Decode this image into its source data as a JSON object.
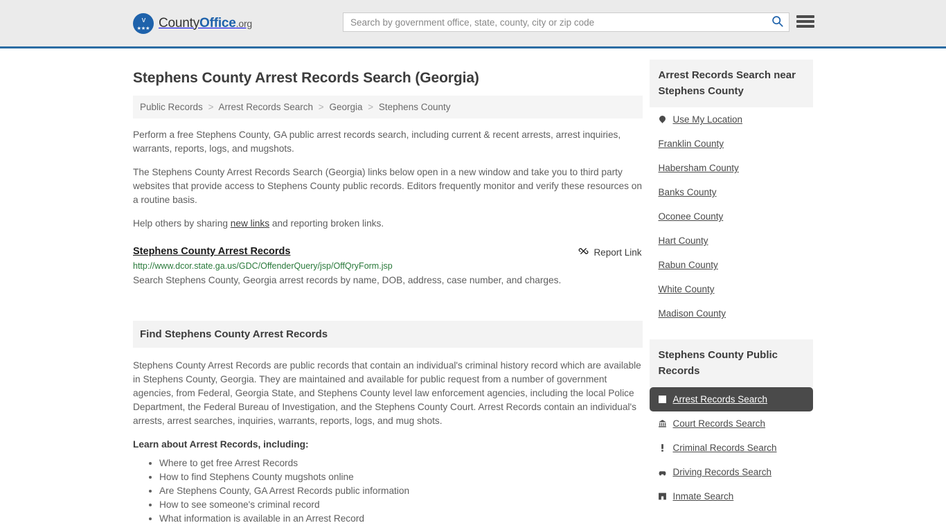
{
  "header": {
    "logo": {
      "county_text": "County",
      "office_text": "Office",
      "org_text": ".org",
      "eagle_glyph": "ᴠ",
      "stars_glyph": "★★★"
    },
    "search": {
      "placeholder": "Search by government office, state, county, city or zip code",
      "value": "",
      "search_icon": "search-icon"
    },
    "menu_icon": "hamburger-menu-icon"
  },
  "page": {
    "title": "Stephens County Arrest Records Search (Georgia)",
    "breadcrumb": [
      "Public Records",
      "Arrest Records Search",
      "Georgia",
      "Stephens County"
    ],
    "breadcrumb_separator": ">",
    "paragraphs": [
      "Perform a free Stephens County, GA public arrest records search, including current & recent arrests, arrest inquiries, warrants, reports, logs, and mugshots.",
      "The Stephens County Arrest Records Search (Georgia) links below open in a new window and take you to third party websites that provide access to Stephens County public records. Editors frequently monitor and verify these resources on a routine basis."
    ],
    "help_line": {
      "before": "Help others by sharing ",
      "link": "new links",
      "after": " and reporting broken links."
    },
    "result": {
      "title": "Stephens County Arrest Records",
      "report_label": "Report Link",
      "report_icon": "broken-link-icon",
      "url": "http://www.dcor.state.ga.us/GDC/OffenderQuery/jsp/OffQryForm.jsp",
      "description": "Search Stephens County, Georgia arrest records by name, DOB, address, case number, and charges."
    },
    "find_section": {
      "heading": "Find Stephens County Arrest Records",
      "body": "Stephens County Arrest Records are public records that contain an individual's criminal history record which are available in Stephens County, Georgia. They are maintained and available for public request from a number of government agencies, from Federal, Georgia State, and Stephens County level law enforcement agencies, including the local Police Department, the Federal Bureau of Investigation, and the Stephens County Court. Arrest Records contain an individual's arrests, arrest searches, inquiries, warrants, reports, logs, and mug shots.",
      "learn_title": "Learn about Arrest Records, including:",
      "learn_items": [
        "Where to get free Arrest Records",
        "How to find Stephens County mugshots online",
        "Are Stephens County, GA Arrest Records public information",
        "How to see someone's criminal record",
        "What information is available in an Arrest Record"
      ]
    }
  },
  "sidebar": {
    "nearby": {
      "heading": "Arrest Records Search near Stephens County",
      "items": [
        {
          "label": "Use My Location",
          "icon": "map-pin-icon"
        },
        {
          "label": "Franklin County",
          "icon": ""
        },
        {
          "label": "Habersham County",
          "icon": ""
        },
        {
          "label": "Banks County",
          "icon": ""
        },
        {
          "label": "Oconee County",
          "icon": ""
        },
        {
          "label": "Hart County",
          "icon": ""
        },
        {
          "label": "Rabun County",
          "icon": ""
        },
        {
          "label": "White County",
          "icon": ""
        },
        {
          "label": "Madison County",
          "icon": ""
        }
      ]
    },
    "public_records": {
      "heading": "Stephens County Public Records",
      "items": [
        {
          "label": "Arrest Records Search",
          "icon": "fingerprint-card-icon",
          "active": true
        },
        {
          "label": "Court Records Search",
          "icon": "courthouse-icon",
          "active": false
        },
        {
          "label": "Criminal Records Search",
          "icon": "exclamation-icon",
          "active": false
        },
        {
          "label": "Driving Records Search",
          "icon": "car-icon",
          "active": false
        },
        {
          "label": "Inmate Search",
          "icon": "jail-icon",
          "active": false
        }
      ]
    }
  },
  "colors": {
    "header_bg": "#ebebeb",
    "header_border": "#2b6ca3",
    "brand_blue": "#1e62ab",
    "url_green": "#2a7a3b",
    "active_bg": "#4a4a4a",
    "panel_bg": "#f3f3f3"
  }
}
